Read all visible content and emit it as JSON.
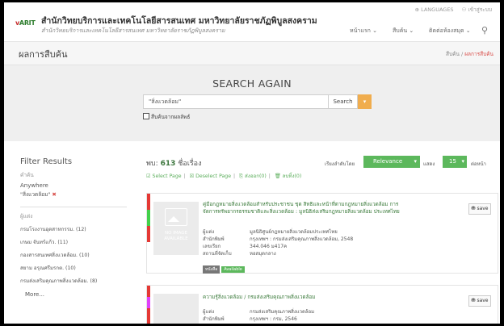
{
  "header": {
    "logo_text": "ARIT",
    "title": "สำนักวิทยบริการและเทคโนโลยีสารสนเทศ มหาวิทยาลัยราชภัฏพิบูลสงคราม",
    "subtitle": "สำนักวิทยบริการและเทคโนโลยีสารสนเทศ มหาวิทยาลัยราชภัฏพิบูลสงคราม",
    "util_languages": "LANGUAGES",
    "util_login": "เข้าสู่ระบบ",
    "nav": [
      "หน้าแรก",
      "สืบค้น",
      "ติดต่อห้องสมุด"
    ]
  },
  "page": {
    "title": "ผลการสืบค้น",
    "breadcrumb_home": "สืบค้น",
    "breadcrumb_current": "ผลการสืบค้น"
  },
  "search": {
    "heading": "SEARCH AGAIN",
    "value": "\"สิ่งแวดล้อม\"",
    "button": "Search",
    "own_checkbox_label": "สืบค้นจากผลลัพธ์"
  },
  "filter": {
    "title": "Filter Results",
    "section_label": "คำค้น",
    "anywhere": "Anywhere",
    "query": "\"สิ่งแวดล้อม\"",
    "group_label": "ผู้แต่ง",
    "items": [
      "กรมโรงงานอุตสาหกรรม. (12)",
      "เกษม จันทร์แก้ว. (11)",
      "กองสารสนเทศสิ่งแวดล้อม. (10)",
      "สยาม อรุณศรีมรกต. (10)",
      "กรมส่งเสริมคุณภาพสิ่งแวดล้อม. (8)"
    ],
    "more": "More..."
  },
  "results": {
    "count_label": "พบ:",
    "count": "613",
    "count_unit": "ชื่อเรื่อง",
    "sort_label": "เรียงลำดับโดย",
    "sort_value": "Relevance",
    "show_label": "แสดง",
    "per_page": "15",
    "per_page_unit": "ต่อหน้า",
    "actions": [
      "Select Page",
      "Deselect Page",
      "ส่งออก(0)",
      "ลบทิ้ง(0)"
    ],
    "items": [
      {
        "title": "คู่มือกฎหมายสิ่งแวดล้อมสำหรับประชาชน ชุด สิทธิและหน้าที่ตามกฎหมายสิ่งแวดล้อม การจัดการทรัพยากรธรรมชาติและสิ่งแวดล้อม : มูลนิธิส่งเสริมกฎหมายสิ่งแวดล้อม ประเทศไทย",
        "thumb_text": "NO IMAGE AVAILABLE",
        "meta": [
          {
            "k": "ผู้แต่ง",
            "v": "มูลนิธิศูนย์กฎหมายสิ่งแวดล้อมประเทศไทย"
          },
          {
            "k": "สำนักพิมพ์",
            "v": "กรุงเทพฯ : กรมส่งเสริมคุณภาพสิ่งแวดล้อม, 2548"
          },
          {
            "k": "เลขเรียก",
            "v": "344.046 ม417ค"
          },
          {
            "k": "สถานที่จัดเก็บ",
            "v": "หอสมุดกลาง"
          }
        ],
        "badge_type": "หนังสือ",
        "badge_status": "Available",
        "save": "save"
      },
      {
        "title": "ความรู้สิ่งแวดล้อม / กรมส่งเสริมคุณภาพสิ่งแวดล้อม",
        "meta": [
          {
            "k": "ผู้แต่ง",
            "v": "กรมส่งเสริมคุณภาพสิ่งแวดล้อม"
          },
          {
            "k": "สำนักพิมพ์",
            "v": "กรุงเทพฯ : กรม, 2546"
          }
        ],
        "save": "save"
      }
    ]
  },
  "colors": {
    "green": "#5cb85c",
    "orange": "#f0ad4e",
    "red": "#d9534f",
    "bar_red": "#e53935",
    "bar_green": "#43d04a",
    "bar_magenta": "#e040fb"
  }
}
